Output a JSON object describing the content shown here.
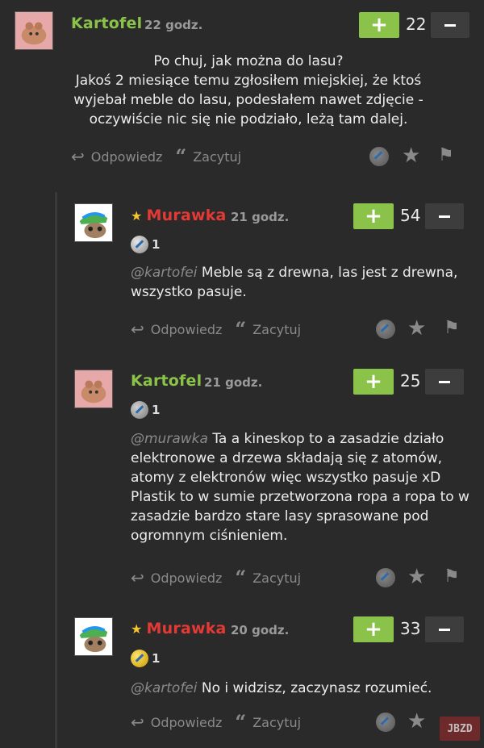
{
  "comments": [
    {
      "user": "Kartofel",
      "star": "",
      "time": "22 godz.",
      "votes": "22",
      "badge_count": "",
      "mention": "",
      "text": "Po chuj, jak można do lasu?\nJakoś 2 miesiące temu zgłosiłem miejskiej, że ktoś wyjebał meble do lasu, podesłałem nawet zdjęcie - oczywiście nic się nie podziało, leżą tam dalej."
    },
    {
      "user": "Murawka",
      "star": "★",
      "time": "21 godz.",
      "votes": "54",
      "badge_count": "1",
      "mention": "@kartofei",
      "text": " Meble są z drewna, las jest z drewna, wszystko pasuje."
    },
    {
      "user": "Kartofel",
      "star": "",
      "time": "21 godz.",
      "votes": "25",
      "badge_count": "1",
      "mention": "@murawka",
      "text": " Ta a kineskop to a zasadzie działo elektronowe a drzewa składają się z atomów, atomy z elektronów więc wszystko pasuje xD Plastik to w sumie przetworzona ropa a ropa to w zasadzie bardzo stare lasy sprasowane pod ogromnym ciśnieniem."
    },
    {
      "user": "Murawka",
      "star": "★",
      "time": "20 godz.",
      "votes": "33",
      "badge_count": "1",
      "mention": "@kartofei",
      "text": " No i widzisz, zaczynasz rozumieć."
    }
  ],
  "actions": {
    "reply": "Odpowiedz",
    "quote": "Zacytuj",
    "plus": "+"
  },
  "watermark": "JBZD",
  "icons": [
    "reply-arrow-icon",
    "quote-icon",
    "badge-icon",
    "star-icon",
    "flag-icon",
    "plus-icon",
    "minus-icon"
  ],
  "colors": {
    "background": "#2a2a2a",
    "green": "#8bc34a",
    "red": "#e53935",
    "muted": "#8a8a8a"
  }
}
